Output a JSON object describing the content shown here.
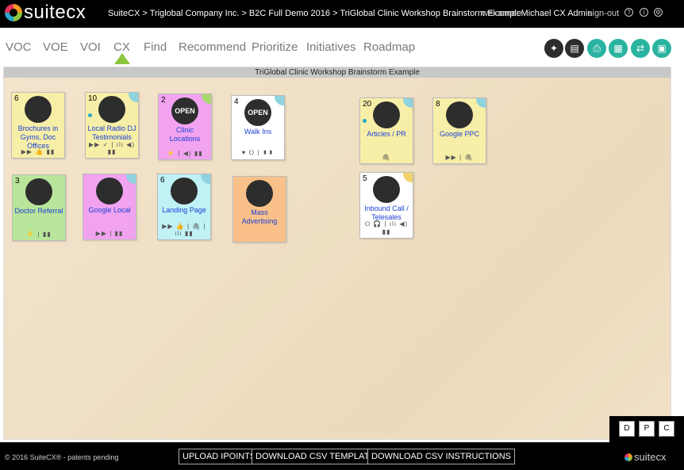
{
  "app": {
    "brand": "suitecx",
    "breadcrumb": "SuiteCX > Triglobal Company Inc. > B2C Full Demo 2016 > TriGlobal Clinic Workshop Brainstorm Example",
    "welcome_prefix": "welcome:",
    "user": "Michael CX Admin",
    "signout": "sign-out"
  },
  "nav": {
    "items": [
      "VOC",
      "VOE",
      "VOI",
      "CX",
      "Find",
      "Recommend",
      "Prioritize",
      "Initiatives",
      "Roadmap"
    ],
    "active": "CX"
  },
  "toolbar": {
    "icons": [
      "pin-icon",
      "storyboard-icon",
      "print-icon",
      "grid-icon",
      "export-icon",
      "filter-icon"
    ]
  },
  "canvas": {
    "title": "TriGlobal Clinic Workshop Brainstorm Example"
  },
  "cards": [
    {
      "count": "6",
      "label": "Brochures in Gyms, Doc Offices",
      "icon": "map-icon",
      "icon_text": "",
      "bg": "#f7efa8",
      "corner": "",
      "footer": "▶▶ 👍 ▮▮"
    },
    {
      "count": "10",
      "label": "Local Radio DJ Testimonials",
      "icon": "radio-icon",
      "icon_text": "",
      "bg": "#f7efa8",
      "corner": "#8fd3e0",
      "footer": "▶▶ ✓ | ılı ◀) ▮▮"
    },
    {
      "count": "2",
      "label": "Clinic Locations",
      "icon": "open-sign-icon",
      "icon_text": "OPEN",
      "bg": "#f2a3f0",
      "corner": "#a9d86e",
      "footer": "⚡ | ◀) ▮▮"
    },
    {
      "count": "4",
      "label": "Walk Ins",
      "icon": "open-sign-icon",
      "icon_text": "OPEN",
      "bg": "#ffffff",
      "corner": "#8fd3e0",
      "footer": "♥ ⭘ | ▮▮"
    },
    {
      "count": "20",
      "label": "Articles / PR",
      "icon": "book-icon",
      "icon_text": "",
      "bg": "#f7efa8",
      "corner": "#8fd3e0",
      "footer": "🖇"
    },
    {
      "count": "8",
      "label": "Google PPC",
      "icon": "web-icon",
      "icon_text": "",
      "bg": "#f7efa8",
      "corner": "#8fd3e0",
      "footer": "▶▶ | 🖇"
    },
    {
      "count": "3",
      "label": "Doctor Referral",
      "icon": "refresh-icon",
      "icon_text": "",
      "bg": "#b9e59a",
      "corner": "",
      "footer": "⚡ | ▮▮"
    },
    {
      "count": "",
      "label": "Google Local",
      "icon": "web-icon",
      "icon_text": "",
      "bg": "#f2a3f0",
      "corner": "#8fd3e0",
      "footer": "▶▶ | ▮▮"
    },
    {
      "count": "6",
      "label": "Landing Page",
      "icon": "web-icon",
      "icon_text": "",
      "bg": "#bff1f5",
      "corner": "#8fd3e0",
      "footer": "▶▶ 👍 | 🖇 | ılı ▮▮"
    },
    {
      "count": "",
      "label": "Mass Advertising",
      "icon": "media-icon",
      "icon_text": "",
      "bg": "#f9c189",
      "corner": "",
      "footer": ""
    },
    {
      "count": "5",
      "label": "Inbound Call / Telesales",
      "icon": "headset-icon",
      "icon_text": "",
      "bg": "#ffffff",
      "corner": "#f2d36a",
      "footer": "⭘ 🎧 | ılı ◀) ▮▮"
    }
  ],
  "view_toggle": [
    "D",
    "P",
    "C"
  ],
  "footer": {
    "copyright": "© 2016 SuiteCX® - patents pending",
    "buttons": [
      "UPLOAD IPOINTS",
      "DOWNLOAD CSV TEMPLATE",
      "DOWNLOAD CSV INSTRUCTIONS"
    ],
    "logo": "suitecx"
  },
  "colors": {
    "accent_green": "#8cc63e",
    "link_blue": "#1a3fd6",
    "toolbar_teal": "#2bb3a1"
  }
}
